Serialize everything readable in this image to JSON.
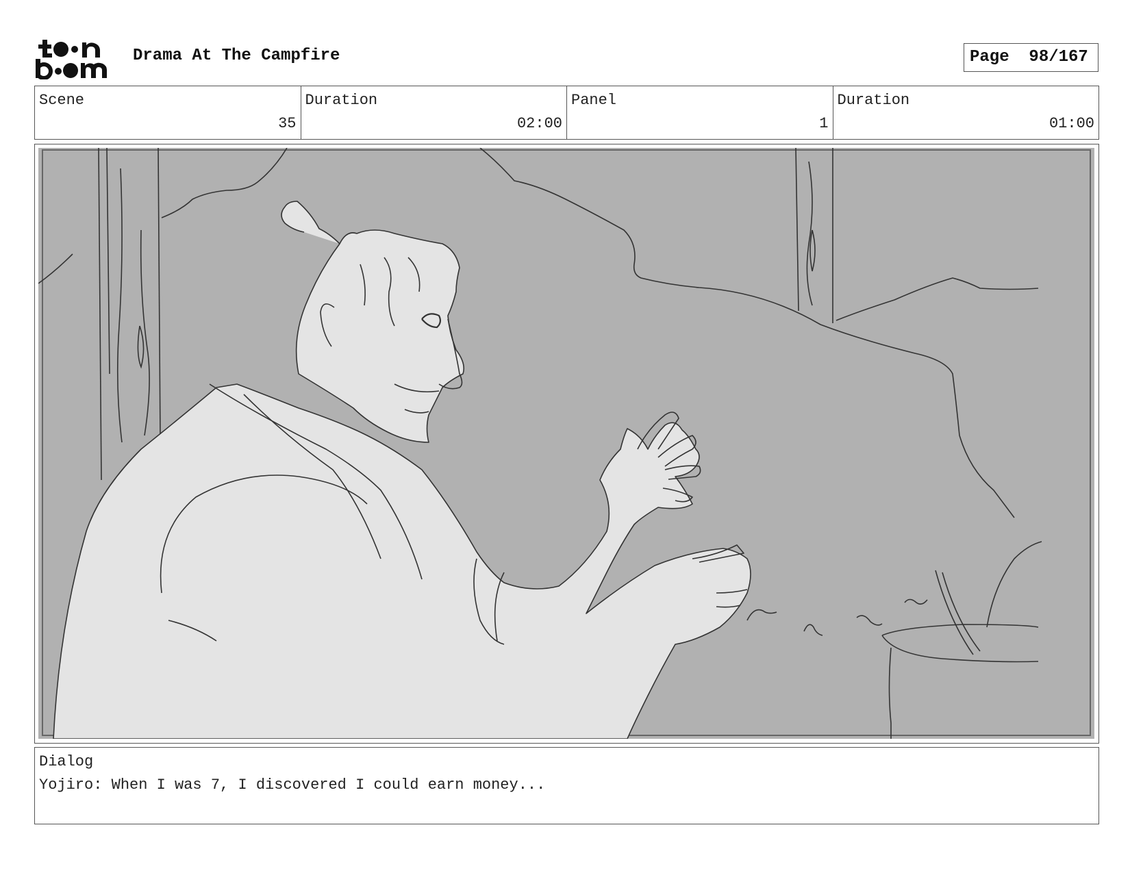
{
  "header": {
    "logo_text": "toonboom",
    "project_title": "Drama At The Campfire",
    "page_label": "Page",
    "page_number": "98/167"
  },
  "info": {
    "scene_label": "Scene",
    "scene_value": "35",
    "scene_duration_label": "Duration",
    "scene_duration_value": "02:00",
    "panel_label": "Panel",
    "panel_value": "1",
    "panel_duration_label": "Duration",
    "panel_duration_value": "01:00"
  },
  "dialog": {
    "label": "Dialog",
    "text": "Yojiro: When I was 7, I discovered I could earn money..."
  },
  "colors": {
    "panel_background": "#b1b1b1",
    "figure_fill": "#e4e4e4",
    "line": "#333333"
  }
}
